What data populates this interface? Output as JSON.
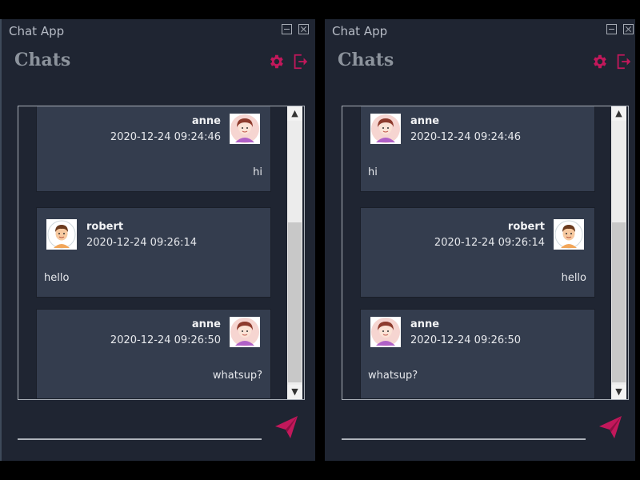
{
  "windows": [
    {
      "title": "Chat App",
      "heading": "Chats",
      "messages": [
        {
          "user": "anne",
          "timestamp": "2020-12-24 09:24:46",
          "text": "hi",
          "avatar": "girl-avatar-icon"
        },
        {
          "user": "robert",
          "timestamp": "2020-12-24 09:26:14",
          "text": "hello",
          "avatar": "boy-avatar-icon"
        },
        {
          "user": "anne",
          "timestamp": "2020-12-24 09:26:50",
          "text": "whatsup?",
          "avatar": "girl-avatar-icon"
        }
      ]
    },
    {
      "title": "Chat App",
      "heading": "Chats",
      "messages": [
        {
          "user": "anne",
          "timestamp": "2020-12-24 09:24:46",
          "text": "hi",
          "avatar": "girl-avatar-icon"
        },
        {
          "user": "robert",
          "timestamp": "2020-12-24 09:26:14",
          "text": "hello",
          "avatar": "boy-avatar-icon"
        },
        {
          "user": "anne",
          "timestamp": "2020-12-24 09:26:50",
          "text": "whatsup?",
          "avatar": "girl-avatar-icon"
        }
      ]
    }
  ],
  "colors": {
    "window_bg": "#1f2532",
    "message_bg": "#343d4e",
    "accent": "#c2185b",
    "heading": "#8c939c"
  },
  "icons": [
    "minimize-icon",
    "close-icon",
    "gear-icon",
    "logout-icon",
    "send-icon"
  ]
}
